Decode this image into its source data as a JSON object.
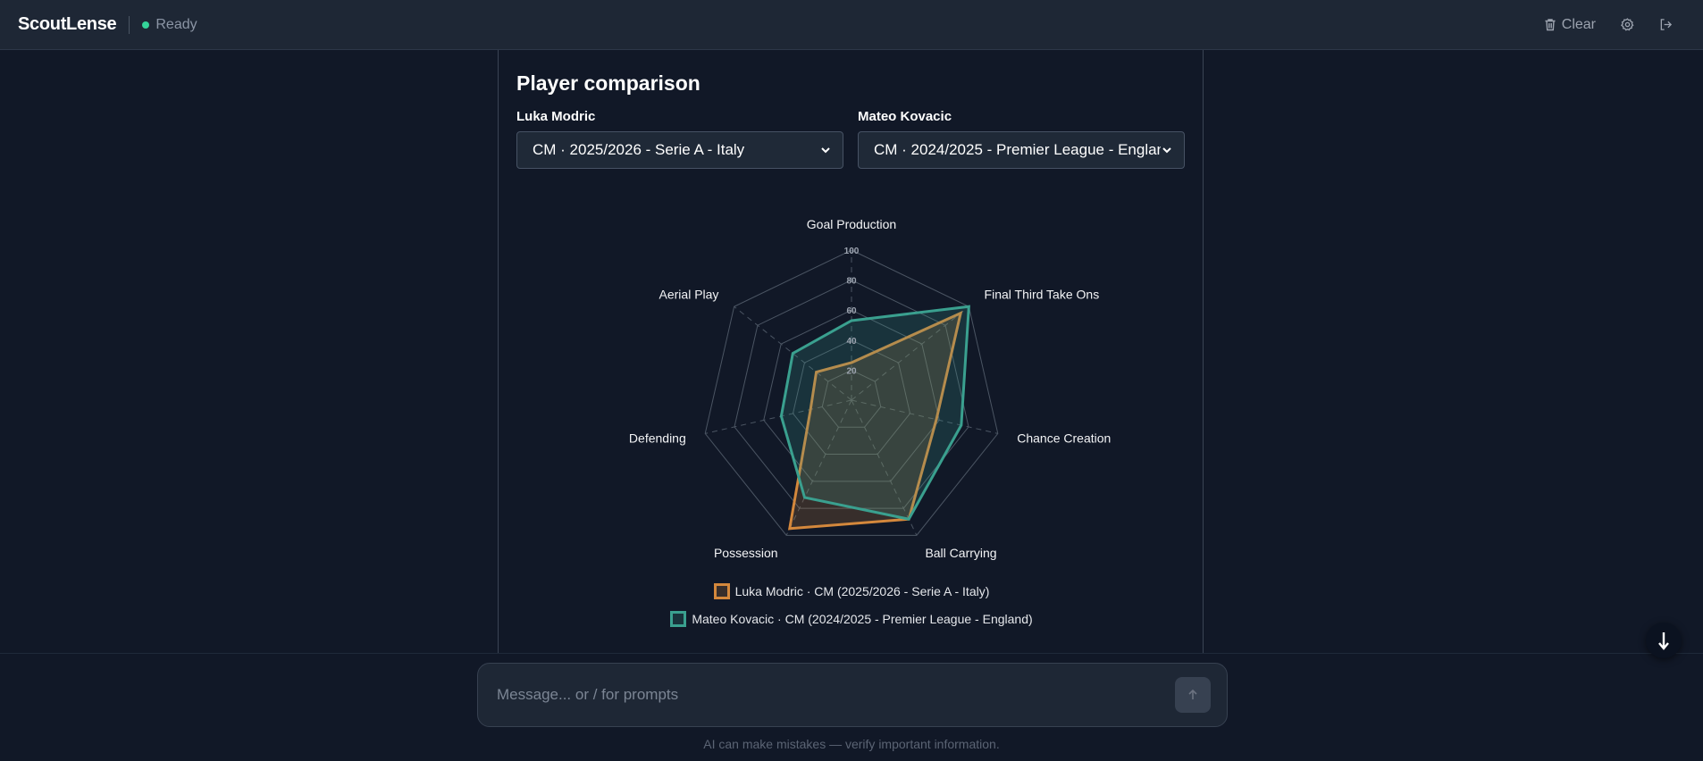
{
  "app": {
    "name": "ScoutLense",
    "status": "Ready"
  },
  "header": {
    "clear_label": "Clear"
  },
  "comparison": {
    "title": "Player comparison",
    "players": [
      {
        "name": "Luka Modric",
        "selected": "CM · 2025/2026 - Serie A - Italy"
      },
      {
        "name": "Mateo Kovacic",
        "selected": "CM · 2024/2025 - Premier League - England"
      }
    ]
  },
  "chart_data": {
    "type": "radar",
    "axes": [
      "Goal Production",
      "Final Third Take Ons",
      "Chance Creation",
      "Ball Carrying",
      "Possession",
      "Defending",
      "Aerial Play"
    ],
    "rticks": [
      "20",
      "40",
      "60",
      "80",
      "100"
    ],
    "rmax": 100,
    "grid": true,
    "legend_position": "bottom",
    "series": [
      {
        "name": "Luka Modric · CM (2025/2026 - Serie A - Italy)",
        "color": "#d4883c",
        "values": [
          25,
          93,
          58,
          88,
          95,
          28,
          30
        ]
      },
      {
        "name": "Mateo Kovacic · CM (2024/2025 - Premier League - England)",
        "color": "#3aa08f",
        "values": [
          53,
          100,
          75,
          88,
          72,
          48,
          50
        ]
      }
    ]
  },
  "composer": {
    "placeholder": "Message... or / for prompts"
  },
  "footer": {
    "disclaimer": "AI can make mistakes — verify important information."
  }
}
